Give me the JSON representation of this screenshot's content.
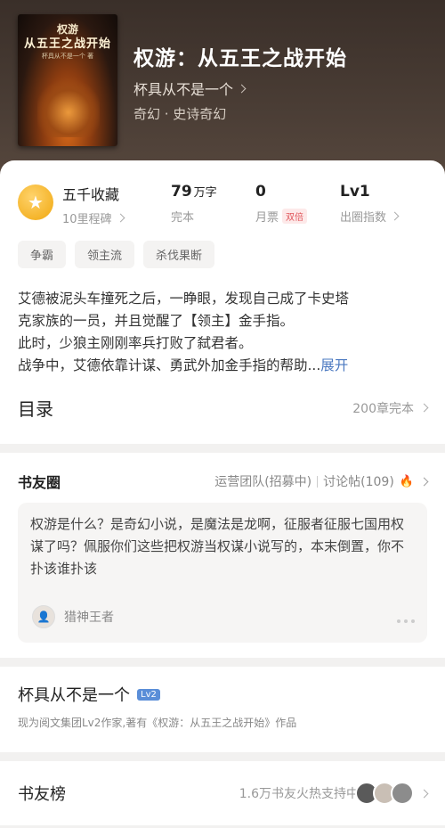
{
  "book": {
    "cover_series": "权游",
    "cover_title": "从五王之战开始",
    "cover_author": "杯具从不是一个 著",
    "title": "权游：从五王之战开始",
    "author": "杯具从不是一个",
    "genres": "奇幻 · 史诗奇幻"
  },
  "stats": {
    "milestone_title": "五千收藏",
    "milestone_sub": "10里程碑",
    "words_value": "79",
    "words_unit": "万字",
    "words_label": "完本",
    "tickets_value": "0",
    "tickets_label": "月票",
    "tickets_badge": "双倍",
    "level_value": "Lv1",
    "level_label": "出圈指数"
  },
  "tags": [
    "争霸",
    "领主流",
    "杀伐果断"
  ],
  "description": {
    "lines": [
      "艾德被泥头车撞死之后，一睁眼，发现自己成了卡史塔",
      "克家族的一员，并且觉醒了【领主】金手指。",
      "此时，少狼主刚刚率兵打败了弑君者。",
      "战争中，艾德依靠计谋、勇武外加金手指的帮助..."
    ],
    "more": "展开"
  },
  "toc": {
    "title": "目录",
    "info": "200章完本"
  },
  "circle": {
    "title": "书友圈",
    "ops": "运营团队(招募中)",
    "posts_count": "讨论帖(109)",
    "post_text": "权游是什么？是奇幻小说，是魔法是龙啊，征服者征服七国用权谋了吗？佩服你们这些把权游当权谋小说写的，本末倒置，你不扑该谁扑该",
    "post_user": "猎神王者"
  },
  "author_card": {
    "name": "杯具从不是一个",
    "level": "Lv2",
    "intro": "现为阅文集团Lv2作家,著有《权游：从五王之战开始》作品"
  },
  "rank": {
    "title": "书友榜",
    "info": "1.6万书友火热支持中"
  },
  "colors": {
    "accent_blue": "#4a78c0",
    "medal_gold": "#f0a70f",
    "hot_red": "#e0454a"
  }
}
